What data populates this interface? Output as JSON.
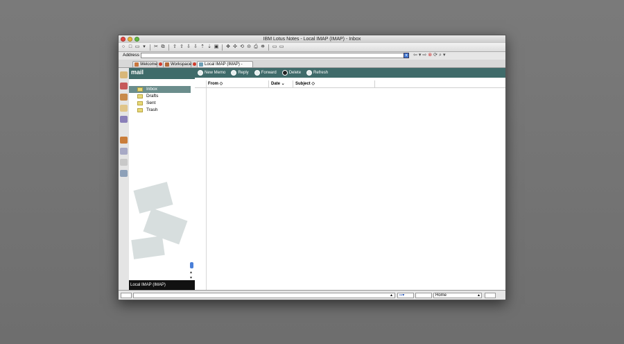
{
  "window": {
    "title": "IBM Lotus Notes - Local IMAP (IMAP) - Inbox"
  },
  "address": {
    "label": "Address",
    "value": ""
  },
  "tabs": [
    {
      "label": "Welcome"
    },
    {
      "label": "Workspace"
    },
    {
      "label": "Local IMAP (IMAP) - Inbox"
    }
  ],
  "nav": {
    "title": "mail",
    "folders": [
      {
        "label": "Inbox",
        "selected": true
      },
      {
        "label": "Drafts"
      },
      {
        "label": "Sent"
      },
      {
        "label": "Trash"
      }
    ],
    "footer": "Local IMAP (IMAP)"
  },
  "actions": [
    {
      "label": "New Memo",
      "icon": "new-memo-icon"
    },
    {
      "label": "Reply",
      "icon": "reply-icon"
    },
    {
      "label": "Forward",
      "icon": "forward-icon"
    },
    {
      "label": "Delete",
      "icon": "delete-icon"
    },
    {
      "label": "Refresh",
      "icon": "refresh-icon"
    }
  ],
  "columns": [
    {
      "label": "From ◇"
    },
    {
      "label": "Date ⌄"
    },
    {
      "label": "Subject ◇"
    }
  ],
  "status": {
    "location": "Home"
  },
  "colors": {
    "accent": "#3f6b6a",
    "selection": "#6b8d8c"
  }
}
